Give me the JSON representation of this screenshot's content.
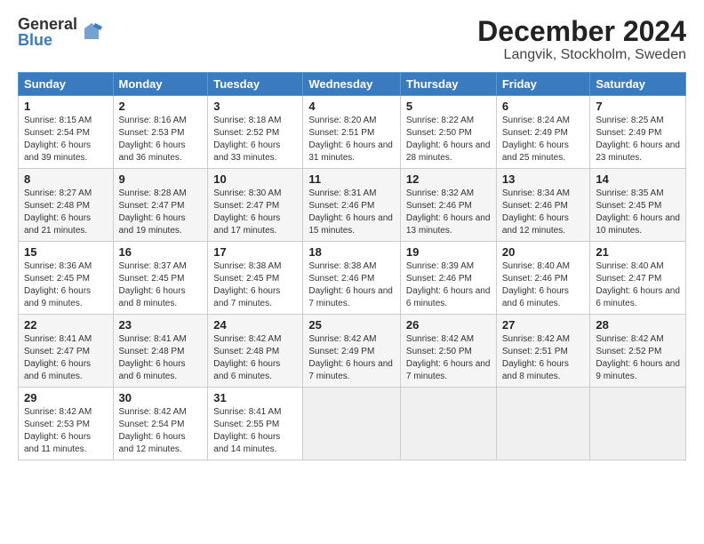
{
  "logo": {
    "general": "General",
    "blue": "Blue"
  },
  "title": "December 2024",
  "subtitle": "Langvik, Stockholm, Sweden",
  "days_header": [
    "Sunday",
    "Monday",
    "Tuesday",
    "Wednesday",
    "Thursday",
    "Friday",
    "Saturday"
  ],
  "weeks": [
    [
      {
        "day": "1",
        "sunrise": "Sunrise: 8:15 AM",
        "sunset": "Sunset: 2:54 PM",
        "daylight": "Daylight: 6 hours and 39 minutes."
      },
      {
        "day": "2",
        "sunrise": "Sunrise: 8:16 AM",
        "sunset": "Sunset: 2:53 PM",
        "daylight": "Daylight: 6 hours and 36 minutes."
      },
      {
        "day": "3",
        "sunrise": "Sunrise: 8:18 AM",
        "sunset": "Sunset: 2:52 PM",
        "daylight": "Daylight: 6 hours and 33 minutes."
      },
      {
        "day": "4",
        "sunrise": "Sunrise: 8:20 AM",
        "sunset": "Sunset: 2:51 PM",
        "daylight": "Daylight: 6 hours and 31 minutes."
      },
      {
        "day": "5",
        "sunrise": "Sunrise: 8:22 AM",
        "sunset": "Sunset: 2:50 PM",
        "daylight": "Daylight: 6 hours and 28 minutes."
      },
      {
        "day": "6",
        "sunrise": "Sunrise: 8:24 AM",
        "sunset": "Sunset: 2:49 PM",
        "daylight": "Daylight: 6 hours and 25 minutes."
      },
      {
        "day": "7",
        "sunrise": "Sunrise: 8:25 AM",
        "sunset": "Sunset: 2:49 PM",
        "daylight": "Daylight: 6 hours and 23 minutes."
      }
    ],
    [
      {
        "day": "8",
        "sunrise": "Sunrise: 8:27 AM",
        "sunset": "Sunset: 2:48 PM",
        "daylight": "Daylight: 6 hours and 21 minutes."
      },
      {
        "day": "9",
        "sunrise": "Sunrise: 8:28 AM",
        "sunset": "Sunset: 2:47 PM",
        "daylight": "Daylight: 6 hours and 19 minutes."
      },
      {
        "day": "10",
        "sunrise": "Sunrise: 8:30 AM",
        "sunset": "Sunset: 2:47 PM",
        "daylight": "Daylight: 6 hours and 17 minutes."
      },
      {
        "day": "11",
        "sunrise": "Sunrise: 8:31 AM",
        "sunset": "Sunset: 2:46 PM",
        "daylight": "Daylight: 6 hours and 15 minutes."
      },
      {
        "day": "12",
        "sunrise": "Sunrise: 8:32 AM",
        "sunset": "Sunset: 2:46 PM",
        "daylight": "Daylight: 6 hours and 13 minutes."
      },
      {
        "day": "13",
        "sunrise": "Sunrise: 8:34 AM",
        "sunset": "Sunset: 2:46 PM",
        "daylight": "Daylight: 6 hours and 12 minutes."
      },
      {
        "day": "14",
        "sunrise": "Sunrise: 8:35 AM",
        "sunset": "Sunset: 2:45 PM",
        "daylight": "Daylight: 6 hours and 10 minutes."
      }
    ],
    [
      {
        "day": "15",
        "sunrise": "Sunrise: 8:36 AM",
        "sunset": "Sunset: 2:45 PM",
        "daylight": "Daylight: 6 hours and 9 minutes."
      },
      {
        "day": "16",
        "sunrise": "Sunrise: 8:37 AM",
        "sunset": "Sunset: 2:45 PM",
        "daylight": "Daylight: 6 hours and 8 minutes."
      },
      {
        "day": "17",
        "sunrise": "Sunrise: 8:38 AM",
        "sunset": "Sunset: 2:45 PM",
        "daylight": "Daylight: 6 hours and 7 minutes."
      },
      {
        "day": "18",
        "sunrise": "Sunrise: 8:38 AM",
        "sunset": "Sunset: 2:46 PM",
        "daylight": "Daylight: 6 hours and 7 minutes."
      },
      {
        "day": "19",
        "sunrise": "Sunrise: 8:39 AM",
        "sunset": "Sunset: 2:46 PM",
        "daylight": "Daylight: 6 hours and 6 minutes."
      },
      {
        "day": "20",
        "sunrise": "Sunrise: 8:40 AM",
        "sunset": "Sunset: 2:46 PM",
        "daylight": "Daylight: 6 hours and 6 minutes."
      },
      {
        "day": "21",
        "sunrise": "Sunrise: 8:40 AM",
        "sunset": "Sunset: 2:47 PM",
        "daylight": "Daylight: 6 hours and 6 minutes."
      }
    ],
    [
      {
        "day": "22",
        "sunrise": "Sunrise: 8:41 AM",
        "sunset": "Sunset: 2:47 PM",
        "daylight": "Daylight: 6 hours and 6 minutes."
      },
      {
        "day": "23",
        "sunrise": "Sunrise: 8:41 AM",
        "sunset": "Sunset: 2:48 PM",
        "daylight": "Daylight: 6 hours and 6 minutes."
      },
      {
        "day": "24",
        "sunrise": "Sunrise: 8:42 AM",
        "sunset": "Sunset: 2:48 PM",
        "daylight": "Daylight: 6 hours and 6 minutes."
      },
      {
        "day": "25",
        "sunrise": "Sunrise: 8:42 AM",
        "sunset": "Sunset: 2:49 PM",
        "daylight": "Daylight: 6 hours and 7 minutes."
      },
      {
        "day": "26",
        "sunrise": "Sunrise: 8:42 AM",
        "sunset": "Sunset: 2:50 PM",
        "daylight": "Daylight: 6 hours and 7 minutes."
      },
      {
        "day": "27",
        "sunrise": "Sunrise: 8:42 AM",
        "sunset": "Sunset: 2:51 PM",
        "daylight": "Daylight: 6 hours and 8 minutes."
      },
      {
        "day": "28",
        "sunrise": "Sunrise: 8:42 AM",
        "sunset": "Sunset: 2:52 PM",
        "daylight": "Daylight: 6 hours and 9 minutes."
      }
    ],
    [
      {
        "day": "29",
        "sunrise": "Sunrise: 8:42 AM",
        "sunset": "Sunset: 2:53 PM",
        "daylight": "Daylight: 6 hours and 11 minutes."
      },
      {
        "day": "30",
        "sunrise": "Sunrise: 8:42 AM",
        "sunset": "Sunset: 2:54 PM",
        "daylight": "Daylight: 6 hours and 12 minutes."
      },
      {
        "day": "31",
        "sunrise": "Sunrise: 8:41 AM",
        "sunset": "Sunset: 2:55 PM",
        "daylight": "Daylight: 6 hours and 14 minutes."
      },
      null,
      null,
      null,
      null
    ]
  ]
}
